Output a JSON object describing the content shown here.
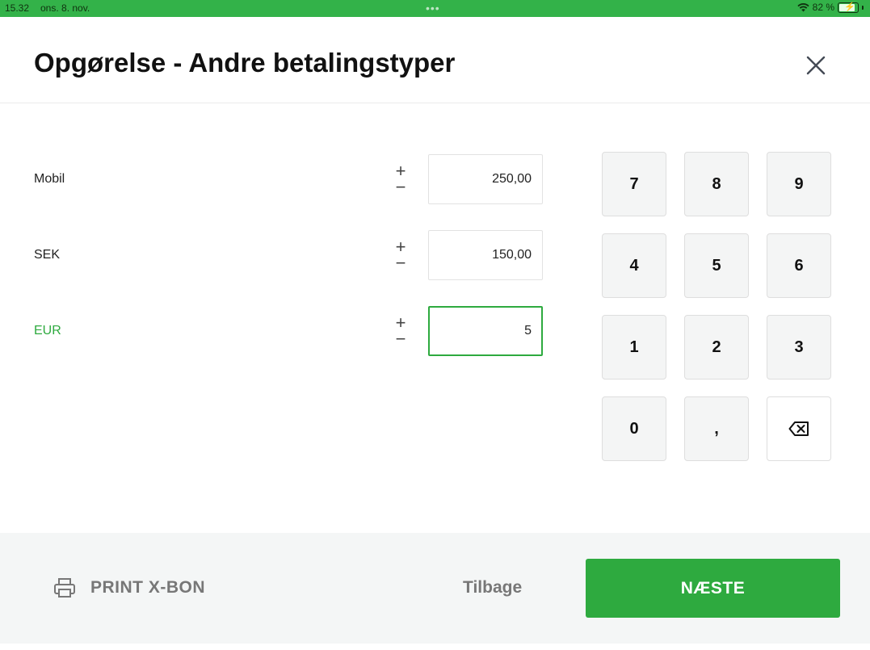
{
  "status_bar": {
    "time": "15.32",
    "date": "ons. 8. nov.",
    "dots": "•••",
    "battery": "82 %"
  },
  "header": {
    "title": "Opgørelse - Andre betalingstyper"
  },
  "rows": [
    {
      "label": "Mobil",
      "plus": "+",
      "minus": "−",
      "value": "250,00"
    },
    {
      "label": "SEK",
      "plus": "+",
      "minus": "−",
      "value": "150,00"
    },
    {
      "label": "EUR",
      "plus": "+",
      "minus": "−",
      "value": "5"
    }
  ],
  "keypad": {
    "keys": [
      "7",
      "8",
      "9",
      "4",
      "5",
      "6",
      "1",
      "2",
      "3",
      "0",
      ","
    ]
  },
  "footer": {
    "print_label": "PRINT X-BON",
    "back_label": "Tilbage",
    "next_label": "NÆSTE"
  },
  "colors": {
    "accent": "#2eaa3f",
    "status_bar": "#33b249"
  },
  "icons": {
    "close": "close-icon",
    "print": "printer-icon",
    "backspace": "backspace-icon",
    "wifi": "wifi-icon",
    "battery": "battery-icon"
  }
}
